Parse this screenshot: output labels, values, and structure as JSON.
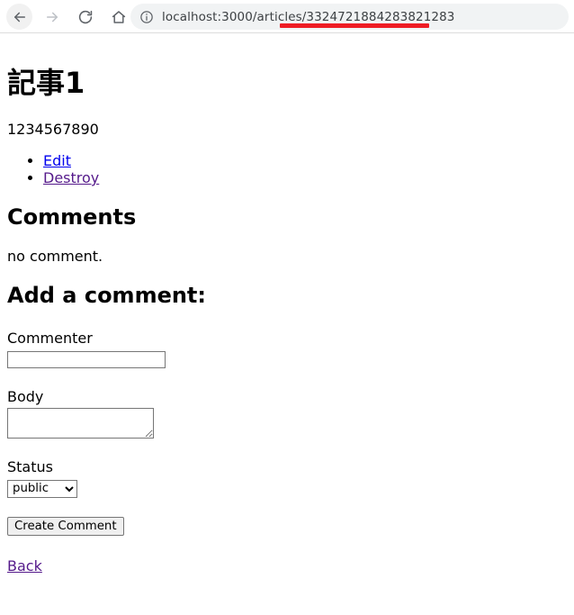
{
  "browser": {
    "back_icon": "arrow-left-icon",
    "forward_icon": "arrow-right-icon",
    "reload_icon": "reload-icon",
    "home_icon": "home-icon",
    "site_info_icon": "info-circle-icon",
    "url": "localhost:3000/articles/3324721884283821283",
    "highlight_color": "#ee1c24",
    "omnibox_bg": "#f1f3f4"
  },
  "page": {
    "title": "記事1",
    "body_text": "1234567890",
    "actions": [
      {
        "label": "Edit",
        "state": "unvisited"
      },
      {
        "label": "Destroy",
        "state": "visited"
      }
    ],
    "comments_heading": "Comments",
    "comments_empty": "no comment.",
    "add_comment_heading": "Add a comment:",
    "form": {
      "commenter_label": "Commenter",
      "commenter_value": "",
      "commenter_placeholder": "",
      "body_label": "Body",
      "body_value": "",
      "body_placeholder": "",
      "status_label": "Status",
      "status_value": "public",
      "status_options": [
        "public"
      ],
      "submit_label": "Create Comment"
    },
    "back_label": "Back",
    "link_color": "#0000ee",
    "visited_link_color": "#551a8b"
  }
}
